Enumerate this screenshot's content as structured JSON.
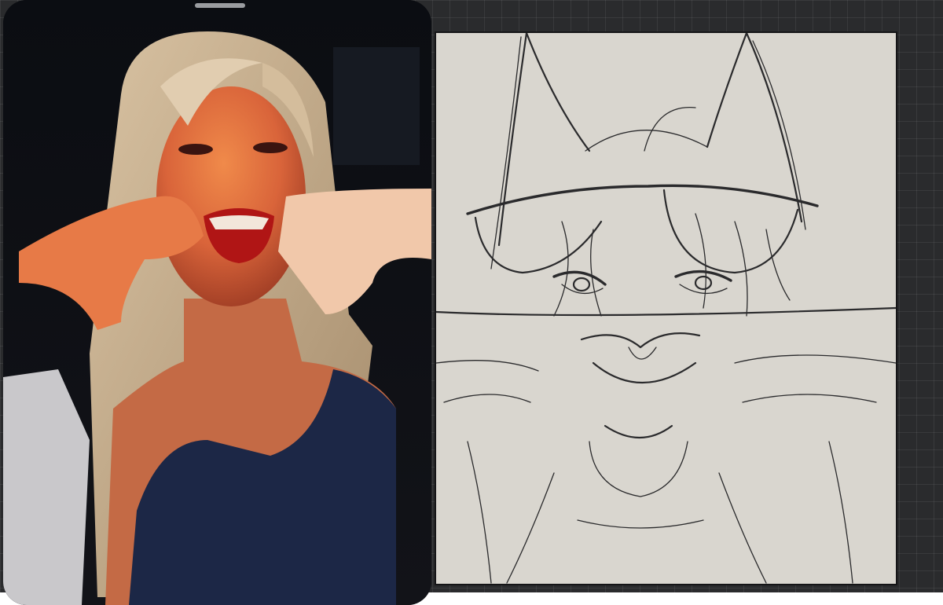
{
  "app": {
    "accent": "#d9d6cf",
    "background": "#2a2b2d"
  },
  "reference_panel": {
    "kind": "photo",
    "subject": "reference-photo",
    "handle_icon": "grab-handle-icon"
  },
  "canvas_panel": {
    "kind": "sketch",
    "paper_color": "#d9d6cf",
    "ink_color": "#2a2a2c"
  }
}
